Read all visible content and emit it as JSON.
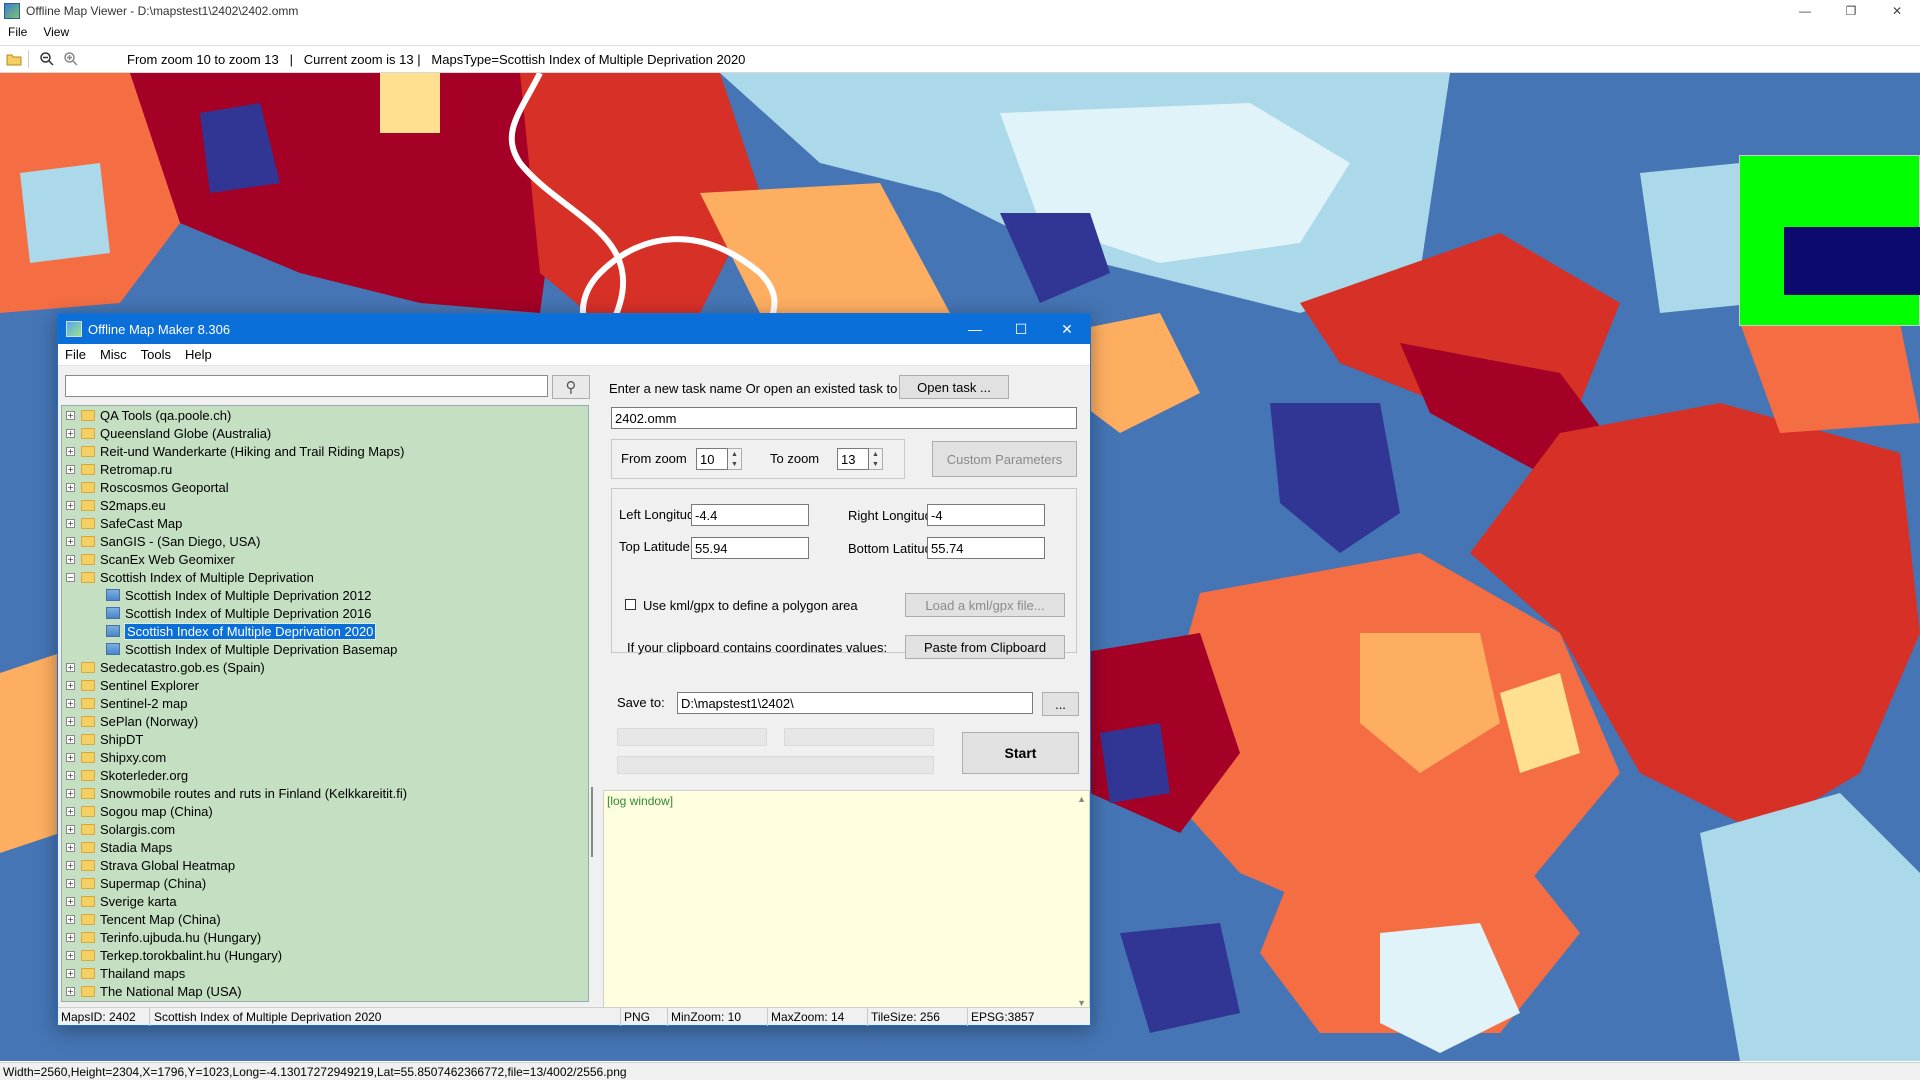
{
  "app": {
    "title": "Offline Map Viewer - D:\\mapstest1\\2402\\2402.omm",
    "menu": [
      "File",
      "View"
    ],
    "window_controls": {
      "minimize": "—",
      "restore": "❐",
      "close": "✕"
    }
  },
  "toolbar": {
    "icons": [
      "open-folder-icon",
      "zoom-out-icon",
      "zoom-in-icon"
    ],
    "status_text": "From zoom 10 to zoom 13   |   Current zoom is 13 |   MapsType=Scottish Index of Multiple Deprivation 2020"
  },
  "statusbar": {
    "text": "Width=2560,Height=2304,X=1796,Y=1023,Long=-4.13017272949219,Lat=55.8507462366772,file=13/4002/2556.png"
  },
  "map_colors": {
    "dark_red": "#a50026",
    "red": "#d73027",
    "orange_red": "#f46d43",
    "orange": "#fdae61",
    "pale_yellow": "#fee090",
    "pale_blue": "#e0f3f8",
    "light_blue": "#abd9e9",
    "mid_blue": "#74add1",
    "blue": "#4575b4",
    "dark_blue": "#313695"
  },
  "minimap": {
    "background": "#00ff00",
    "viewport_color": "#0c0a6e"
  },
  "dialog": {
    "title": "Offline Map Maker 8.306",
    "menu": [
      "File",
      "Misc",
      "Tools",
      "Help"
    ],
    "search": {
      "value": "",
      "placeholder": ""
    },
    "tree": [
      {
        "label": "QA Tools (qa.poole.ch)",
        "expander": "+"
      },
      {
        "label": "Queensland Globe (Australia)",
        "expander": "+"
      },
      {
        "label": "Reit-und Wanderkarte (Hiking and Trail Riding Maps)",
        "expander": "+"
      },
      {
        "label": "Retromap.ru",
        "expander": "+"
      },
      {
        "label": "Roscosmos Geoportal",
        "expander": "+"
      },
      {
        "label": "S2maps.eu",
        "expander": "+"
      },
      {
        "label": "SafeCast Map",
        "expander": "+"
      },
      {
        "label": "SanGIS - (San Diego, USA)",
        "expander": "+"
      },
      {
        "label": "ScanEx Web Geomixer",
        "expander": "+"
      },
      {
        "label": "Scottish Index of Multiple Deprivation",
        "expander": "−",
        "children": [
          {
            "label": "Scottish Index of Multiple Deprivation 2012",
            "selected": false
          },
          {
            "label": "Scottish Index of Multiple Deprivation 2016",
            "selected": false
          },
          {
            "label": "Scottish Index of Multiple Deprivation 2020",
            "selected": true
          },
          {
            "label": "Scottish Index of Multiple Deprivation Basemap",
            "selected": false
          }
        ]
      },
      {
        "label": "Sedecatastro.gob.es (Spain)",
        "expander": "+"
      },
      {
        "label": "Sentinel Explorer",
        "expander": "+"
      },
      {
        "label": "Sentinel-2 map",
        "expander": "+"
      },
      {
        "label": "SePlan (Norway)",
        "expander": "+"
      },
      {
        "label": "ShipDT",
        "expander": "+"
      },
      {
        "label": "Shipxy.com",
        "expander": "+"
      },
      {
        "label": "Skoterleder.org",
        "expander": "+"
      },
      {
        "label": "Snowmobile routes and ruts in Finland (Kelkkareitit.fi)",
        "expander": "+"
      },
      {
        "label": "Sogou map (China)",
        "expander": "+"
      },
      {
        "label": "Solargis.com",
        "expander": "+"
      },
      {
        "label": "Stadia Maps",
        "expander": "+"
      },
      {
        "label": "Strava Global Heatmap",
        "expander": "+"
      },
      {
        "label": "Supermap (China)",
        "expander": "+"
      },
      {
        "label": "Sverige karta",
        "expander": "+"
      },
      {
        "label": "Tencent Map (China)",
        "expander": "+"
      },
      {
        "label": "Terinfo.ujbuda.hu (Hungary)",
        "expander": "+"
      },
      {
        "label": "Terkep.torokbalint.hu (Hungary)",
        "expander": "+"
      },
      {
        "label": "Thailand maps",
        "expander": "+"
      },
      {
        "label": "The National Map (USA)",
        "expander": "+"
      }
    ],
    "form": {
      "task_prompt": "Enter a new task name Or open an existed task to continue:",
      "open_task_label": "Open task ...",
      "task_name": "2402.omm",
      "from_zoom_label": "From zoom",
      "from_zoom": "10",
      "to_zoom_label": "To zoom",
      "to_zoom": "13",
      "custom_params_label": "Custom Parameters",
      "left_lon_label": "Left Longitude",
      "left_lon": "-4.4",
      "right_lon_label": "Right Longitude",
      "right_lon": "-4",
      "top_lat_label": "Top Latitude",
      "top_lat": "55.94",
      "bottom_lat_label": "Bottom Latitude",
      "bottom_lat": "55.74",
      "kml_checkbox_label": "Use kml/gpx to define a polygon area",
      "kml_checked": false,
      "load_kml_label": "Load a kml/gpx file...",
      "clipboard_prompt": "If your clipboard contains coordinates values:",
      "paste_label": "Paste from Clipboard",
      "save_to_label": "Save to:",
      "save_to": "D:\\mapstest1\\2402\\",
      "browse_label": "...",
      "start_label": "Start",
      "progress": [
        0,
        0,
        0
      ]
    },
    "log": {
      "text": "[log window]"
    },
    "statusbar": {
      "maps_id": "MapsID: 2402",
      "map_name": "Scottish Index of Multiple Deprivation 2020",
      "format": "PNG",
      "min_zoom": "MinZoom: 10",
      "max_zoom": "MaxZoom: 14",
      "tile_size": "TileSize: 256",
      "epsg": "EPSG:3857"
    }
  }
}
